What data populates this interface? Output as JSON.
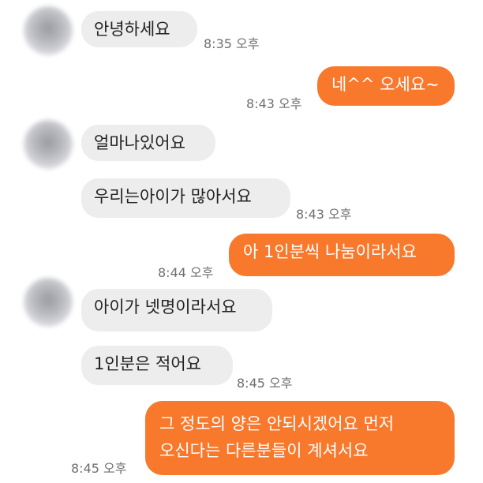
{
  "messages": [
    {
      "side": "in",
      "text": "안녕하세요",
      "time": "8:35 오후"
    },
    {
      "side": "out",
      "text": "네^^ 오세요~",
      "time": "8:43 오후"
    },
    {
      "side": "in",
      "text": "얼마나있어요",
      "time": ""
    },
    {
      "side": "in",
      "text": "우리는아이가 많아서요",
      "time": "8:43 오후"
    },
    {
      "side": "out",
      "text": "아 1인분씩 나눔이라서요",
      "time": "8:44 오후"
    },
    {
      "side": "in",
      "text": "아이가 넷명이라서요",
      "time": ""
    },
    {
      "side": "in",
      "text": "1인분은 적어요",
      "time": "8:45 오후"
    },
    {
      "side": "out",
      "lines": [
        "그 정도의 양은 안되시겠어요 먼저",
        "오신다는 다른분들이 계셔서요"
      ],
      "time": "8:45 오후"
    }
  ],
  "colors": {
    "outgoing_bubble": "#f8782c",
    "incoming_bubble": "#ededee",
    "timestamp": "#6f6f6f",
    "background": "#ffffff"
  },
  "icons": {
    "avatar": "blurred-profile-avatar"
  }
}
